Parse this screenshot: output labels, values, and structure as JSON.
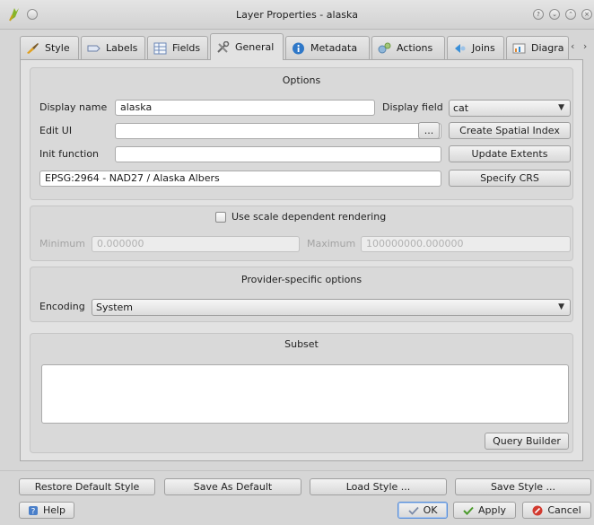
{
  "window": {
    "title": "Layer Properties - alaska"
  },
  "tabs": [
    {
      "label": "Style",
      "icon": "brush-icon"
    },
    {
      "label": "Labels",
      "icon": "label-tag-icon"
    },
    {
      "label": "Fields",
      "icon": "table-icon"
    },
    {
      "label": "General",
      "icon": "tools-icon",
      "active": true
    },
    {
      "label": "Metadata",
      "icon": "info-icon"
    },
    {
      "label": "Actions",
      "icon": "gears-icon"
    },
    {
      "label": "Joins",
      "icon": "join-icon"
    },
    {
      "label": "Diagra",
      "icon": "diagram-icon"
    }
  ],
  "options": {
    "title": "Options",
    "display_name_label": "Display name",
    "display_name_value": "alaska",
    "display_field_label": "Display field",
    "display_field_value": "cat",
    "edit_ui_label": "Edit UI",
    "edit_ui_value": "",
    "browse_label": "...",
    "create_spatial_index_label": "Create Spatial Index",
    "init_function_label": "Init function",
    "init_function_value": "",
    "update_extents_label": "Update Extents",
    "crs_value": "EPSG:2964 - NAD27 / Alaska Albers",
    "specify_crs_label": "Specify CRS"
  },
  "scale": {
    "checkbox_label": "Use scale dependent rendering",
    "checked": false,
    "minimum_label": "Minimum",
    "minimum_value": "0.000000",
    "maximum_label": "Maximum",
    "maximum_value": "100000000.000000"
  },
  "provider": {
    "title": "Provider-specific options",
    "encoding_label": "Encoding",
    "encoding_value": "System"
  },
  "subset": {
    "title": "Subset",
    "text": "",
    "query_builder_label": "Query Builder"
  },
  "style_buttons": {
    "restore_default": "Restore Default Style",
    "save_as_default": "Save As Default",
    "load_style": "Load Style ...",
    "save_style": "Save Style ..."
  },
  "dialog_buttons": {
    "help": "Help",
    "ok": "OK",
    "apply": "Apply",
    "cancel": "Cancel"
  },
  "colors": {
    "accent": "#5a8fd8",
    "cancel_red": "#d23a2f",
    "ok_green": "#4a9a2a"
  }
}
